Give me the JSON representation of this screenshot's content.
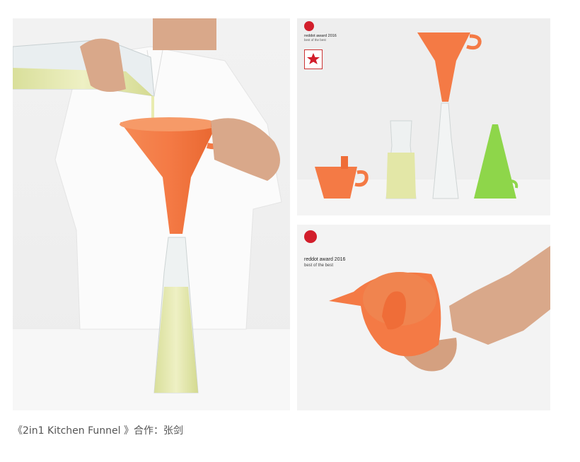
{
  "caption": "《2in1 Kitchen Funnel 》合作：张剑",
  "badges": {
    "top_award_line1": "reddot award 2016",
    "top_award_line2": "best of the best",
    "small_award_line1": "reddot award 2016",
    "small_award_line2": "best of the best"
  },
  "colors": {
    "funnel_orange": "#f47a45",
    "funnel_green": "#8ed64a",
    "oil_yellow": "#e3e7a7",
    "reddot_red": "#d21e2b"
  },
  "images": [
    {
      "name": "main-photo",
      "subject": "person pouring oil through an orange funnel into a bottle"
    },
    {
      "name": "top-right-photo",
      "subject": "orange funnel, glass carafe and bottle, green funnel"
    },
    {
      "name": "bottom-right-photo",
      "subject": "hands holding orange funnel"
    }
  ]
}
